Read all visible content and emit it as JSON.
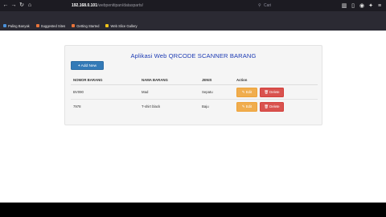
{
  "browser": {
    "url_host": "192.168.0.101",
    "url_path": "/webpenitipan/datasparts/",
    "search_placeholder": "Cari",
    "nav_icons": [
      "back-icon",
      "forward-icon",
      "reload-icon",
      "home-icon"
    ],
    "bookmarks": [
      {
        "label": "Paling Banyak",
        "color": "#4a90d9"
      },
      {
        "label": "Suggested Sites",
        "color": "#e8743b"
      },
      {
        "label": "Getting Started",
        "color": "#e8743b"
      },
      {
        "label": "Web Slice Gallery",
        "color": "#f0c419"
      }
    ]
  },
  "app": {
    "title": "Aplikasi Web QRCODE SCANNER BARANG",
    "add_button": "Add New",
    "columns": [
      "NOMOR BARANG",
      "NAMA BARANG",
      "JENIS",
      "Action"
    ],
    "rows": [
      {
        "nomor": "BV090",
        "nama": "Mad",
        "jenis": "Sepatu",
        "edit": "Edit",
        "delete": "Delete"
      },
      {
        "nomor": "7978",
        "nama": "T-shirt black",
        "jenis": "Baju",
        "edit": "Edit",
        "delete": "Delete"
      }
    ]
  }
}
